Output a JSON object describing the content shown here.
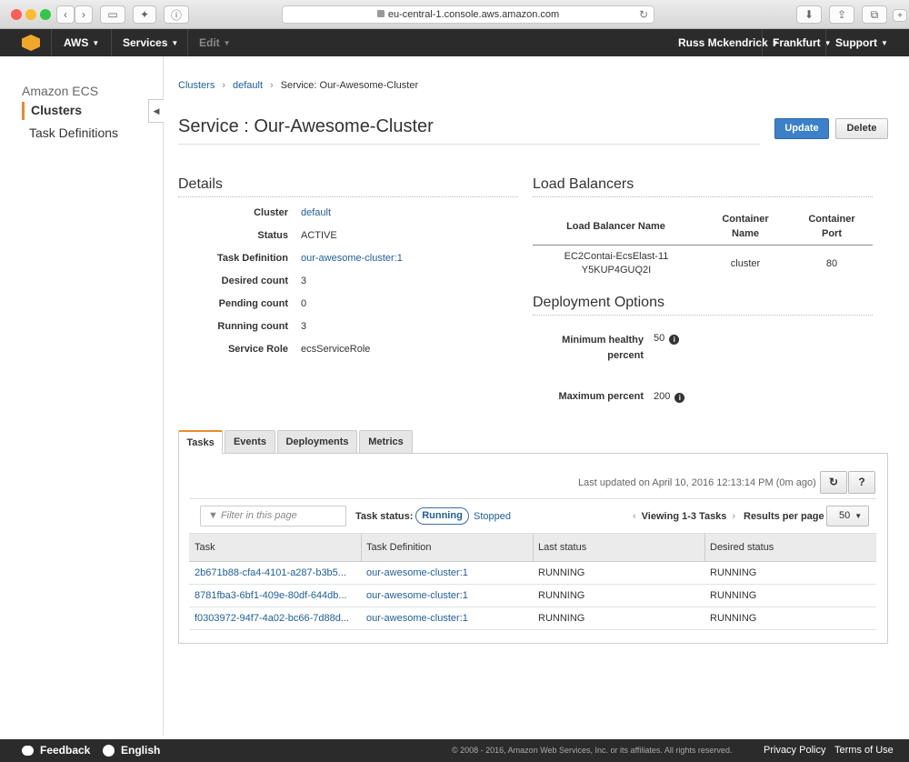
{
  "browser": {
    "url": "eu-central-1.console.aws.amazon.com"
  },
  "nav": {
    "brand": "AWS",
    "services": "Services",
    "edit": "Edit",
    "user": "Russ Mckendrick",
    "region": "Frankfurt",
    "support": "Support"
  },
  "sidebar": {
    "service": "Amazon ECS",
    "items": [
      {
        "label": "Clusters"
      },
      {
        "label": "Task Definitions"
      }
    ]
  },
  "breadcrumb": {
    "items": [
      "Clusters",
      "default",
      "Service: Our-Awesome-Cluster"
    ]
  },
  "page": {
    "title": "Service : Our-Awesome-Cluster",
    "update_label": "Update",
    "delete_label": "Delete"
  },
  "details": {
    "heading": "Details",
    "rows": [
      {
        "label": "Cluster",
        "value": "default"
      },
      {
        "label": "Status",
        "value": "ACTIVE"
      },
      {
        "label": "Task Definition",
        "value": "our-awesome-cluster:1"
      },
      {
        "label": "Desired count",
        "value": "3"
      },
      {
        "label": "Pending count",
        "value": "0"
      },
      {
        "label": "Running count",
        "value": "3"
      },
      {
        "label": "Service Role",
        "value": "ecsServiceRole"
      }
    ]
  },
  "load_balancers": {
    "heading": "Load Balancers",
    "columns": [
      "Load Balancer Name",
      "Container Name",
      "Container Port"
    ],
    "row": {
      "name": "EC2Contai-EcsElast-11Y5KUP4GUQ2I",
      "container": "cluster",
      "port": "80"
    }
  },
  "deployment": {
    "heading": "Deployment Options",
    "min_label": "Minimum healthy percent",
    "min_value": "50",
    "max_label": "Maximum percent",
    "max_value": "200"
  },
  "tabs": [
    "Tasks",
    "Events",
    "Deployments",
    "Metrics"
  ],
  "tasks": {
    "last_updated": "Last updated on April 10, 2016 12:13:14 PM (0m ago)",
    "filter_placeholder": "Filter in this page",
    "status_label": "Task status:",
    "running": "Running",
    "stopped": "Stopped",
    "viewing": "Viewing 1-3 Tasks",
    "rpp_label": "Results per page",
    "rpp_value": "50",
    "columns": [
      "Task",
      "Task Definition",
      "Last status",
      "Desired status"
    ],
    "rows": [
      {
        "task": "2b671b88-cfa4-4101-a287-b3b5...",
        "def": "our-awesome-cluster:1",
        "last": "RUNNING",
        "desired": "RUNNING"
      },
      {
        "task": "8781fba3-6bf1-409e-80df-644db...",
        "def": "our-awesome-cluster:1",
        "last": "RUNNING",
        "desired": "RUNNING"
      },
      {
        "task": "f0303972-94f7-4a02-bc66-7d88d...",
        "def": "our-awesome-cluster:1",
        "last": "RUNNING",
        "desired": "RUNNING"
      }
    ]
  },
  "footer": {
    "feedback": "Feedback",
    "language": "English",
    "copyright": "© 2008 - 2016, Amazon Web Services, Inc. or its affiliates. All rights reserved.",
    "privacy": "Privacy Policy",
    "terms": "Terms of Use"
  },
  "colors": {
    "accent": "#e88b2b",
    "primary_button": "#3b80c8",
    "link": "#1f5e99",
    "nav_bg": "#2b2b2b"
  }
}
